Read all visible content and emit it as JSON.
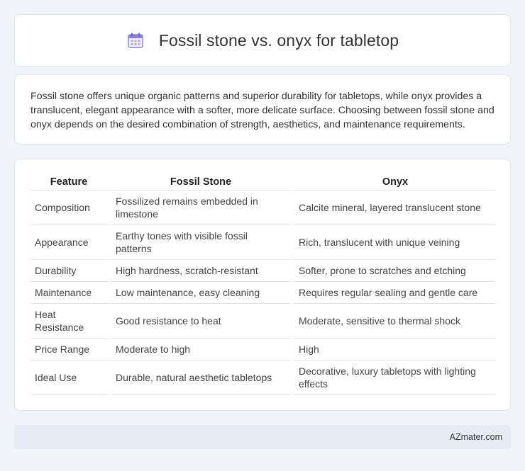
{
  "header": {
    "title": "Fossil stone vs. onyx for tabletop",
    "icon": "calendar-icon"
  },
  "summary": "Fossil stone offers unique organic patterns and superior durability for tabletops, while onyx provides a translucent, elegant appearance with a softer, more delicate surface. Choosing between fossil stone and onyx depends on the desired combination of strength, aesthetics, and maintenance requirements.",
  "table": {
    "headers": [
      "Feature",
      "Fossil Stone",
      "Onyx"
    ],
    "rows": [
      [
        "Composition",
        "Fossilized remains embedded in limestone",
        "Calcite mineral, layered translucent stone"
      ],
      [
        "Appearance",
        "Earthy tones with visible fossil patterns",
        "Rich, translucent with unique veining"
      ],
      [
        "Durability",
        "High hardness, scratch-resistant",
        "Softer, prone to scratches and etching"
      ],
      [
        "Maintenance",
        "Low maintenance, easy cleaning",
        "Requires regular sealing and gentle care"
      ],
      [
        "Heat Resistance",
        "Good resistance to heat",
        "Moderate, sensitive to thermal shock"
      ],
      [
        "Price Range",
        "Moderate to high",
        "High"
      ],
      [
        "Ideal Use",
        "Durable, natural aesthetic tabletops",
        "Decorative, luxury tabletops with lighting effects"
      ]
    ]
  },
  "footer": {
    "site": "AZmater.com"
  },
  "colors": {
    "background": "#f1f4f9",
    "card": "#ffffff",
    "footer": "#e6ecf6",
    "icon_accent": "#7b6fd6"
  }
}
